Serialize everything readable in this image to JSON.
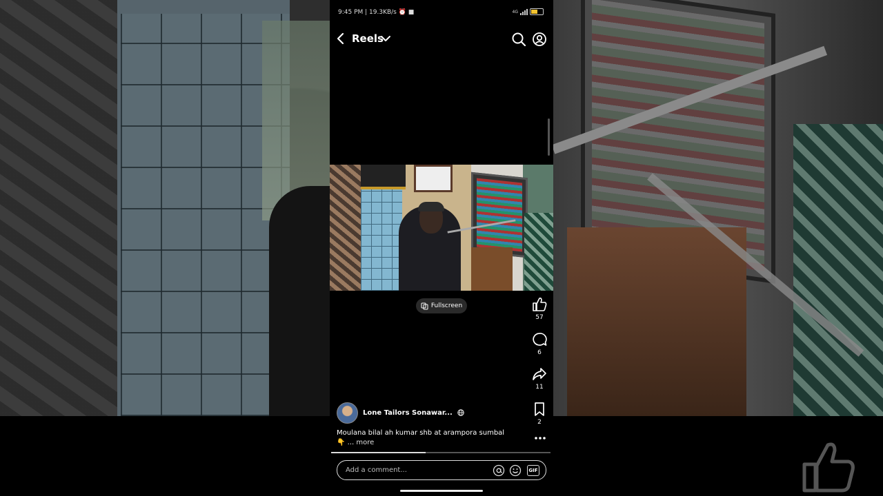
{
  "status_bar": {
    "time": "9:45 PM",
    "speed": "| 19.3KB/s",
    "network": "4G"
  },
  "header": {
    "title": "Reels"
  },
  "video": {
    "fullscreen_label": "Fullscreen"
  },
  "actions": {
    "like_count": "57",
    "comment_count": "6",
    "share_count": "11",
    "save_count": "2"
  },
  "author": {
    "name": "Lone Tailors Sonawar..."
  },
  "caption": {
    "text": "Moulana bilal ah kumar shb at arampora sumbal",
    "emoji": "👇",
    "ellipsis": "...",
    "more_label": "more"
  },
  "playback": {
    "progress": 0.43
  },
  "comment_box": {
    "placeholder": "Add a comment...",
    "gif_label": "GIF"
  },
  "colors": {
    "background": "#000000",
    "battery": "#f2c230"
  }
}
